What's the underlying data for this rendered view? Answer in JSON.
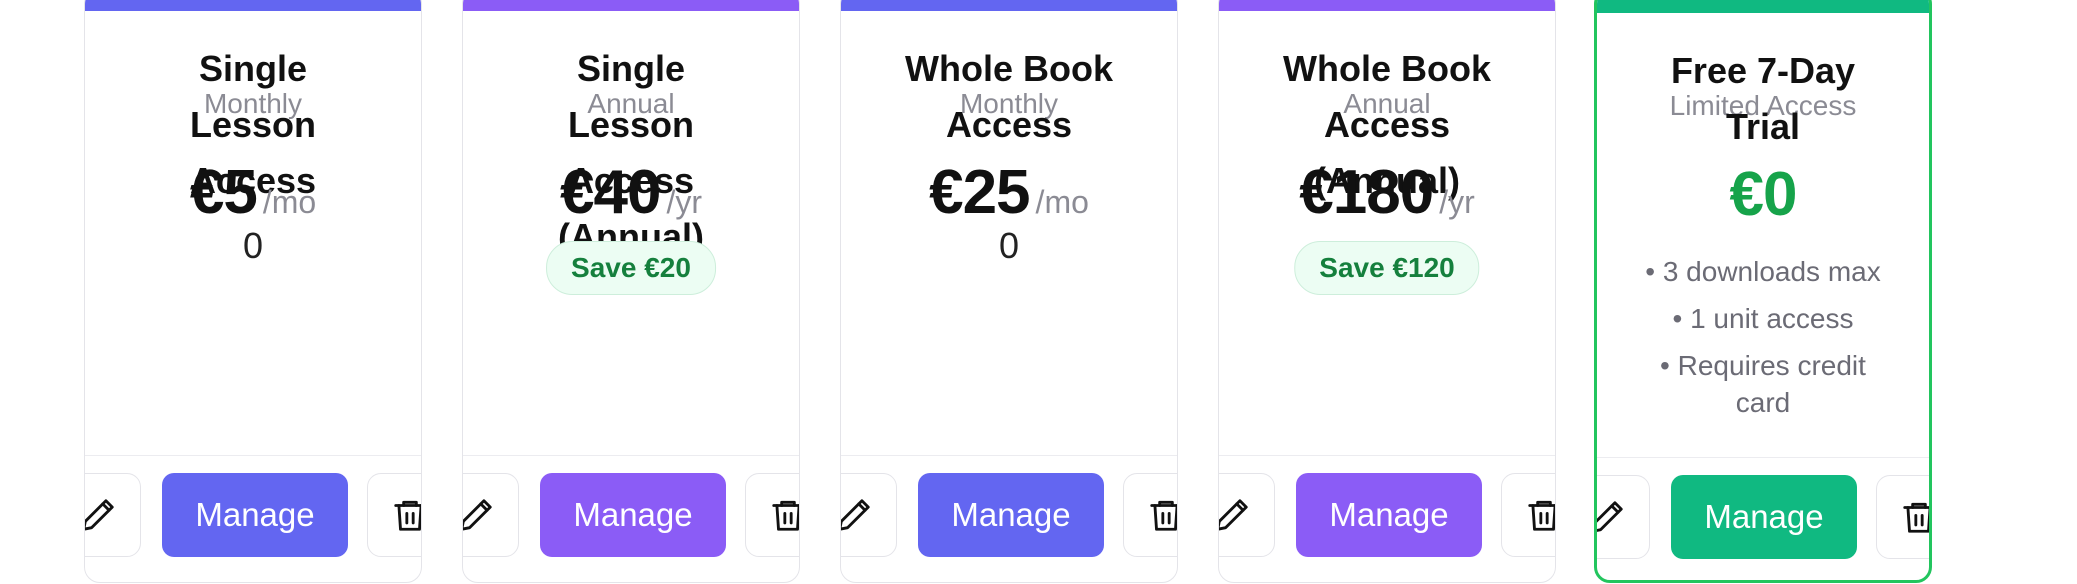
{
  "colors": {
    "indigo": "#6366f1",
    "violet": "#8b5cf6",
    "green": "#10b981",
    "green_border": "#22c55e",
    "price_green": "#16a34a"
  },
  "plans": [
    {
      "title": "Single Lesson Access",
      "subtitle": "Monthly",
      "price": "€5",
      "period": "/mo",
      "extra": "0",
      "accent": "#6366f1",
      "manage_label": "Manage"
    },
    {
      "title": "Single Lesson Access (Annual)",
      "subtitle": "Annual",
      "price": "€40",
      "period": "/yr",
      "badge": "Save €20",
      "accent": "#8b5cf6",
      "manage_label": "Manage"
    },
    {
      "title": "Whole Book Access",
      "subtitle": "Monthly",
      "price": "€25",
      "period": "/mo",
      "extra": "0",
      "accent": "#6366f1",
      "manage_label": "Manage"
    },
    {
      "title": "Whole Book Access (Annual)",
      "subtitle": "Annual",
      "price": "€180",
      "period": "/yr",
      "badge": "Save €120",
      "accent": "#8b5cf6",
      "manage_label": "Manage"
    },
    {
      "title": "Free 7-Day Trial",
      "subtitle": "Limited Access",
      "price": "€0",
      "features": [
        "• 3 downloads max",
        "• 1 unit access",
        "• Requires credit card"
      ],
      "accent": "#10b981",
      "manage_label": "Manage"
    }
  ],
  "icons": {
    "edit": "pencil-icon",
    "delete": "trash-icon"
  }
}
